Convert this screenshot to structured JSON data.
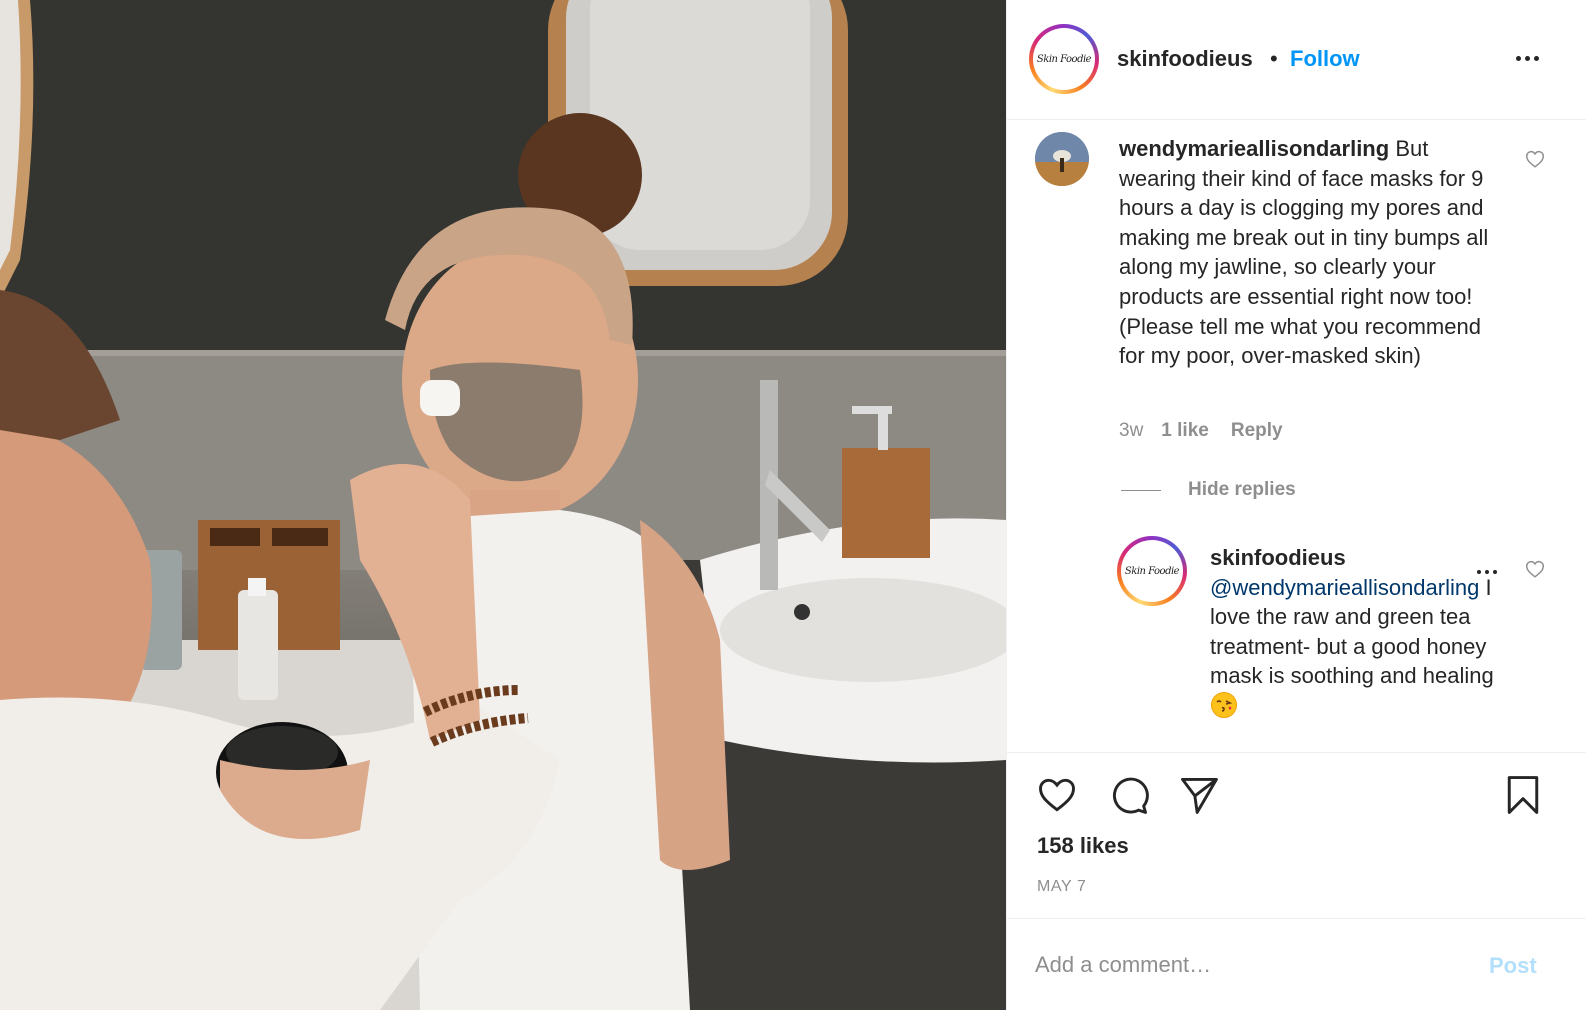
{
  "post": {
    "image_alt": "Woman applying clay face mask to smiling girl in a bathroom",
    "brand_logo_text": "Skin Foodie"
  },
  "header": {
    "username": "skinfoodieus",
    "separator": "•",
    "follow_label": "Follow",
    "more_icon": "more-horizontal-icon"
  },
  "comment": {
    "username": "wendymarieallisondarling",
    "text": "But wearing their kind of face masks for 9 hours a day is clogging my pores and making me break out in tiny bumps all along my jawline, so clearly your products are essential right now too! (Please tell me what you recommend for my poor, over-masked skin)",
    "time": "3w",
    "likes": "1 like",
    "reply_label": "Reply",
    "hide_replies_label": "Hide replies"
  },
  "reply": {
    "username": "skinfoodieus",
    "mention": "@wendymarieallisondarling",
    "text": " I love the raw and green tea treatment- but a good honey mask is soothing and healing",
    "emoji": "face-blowing-a-kiss-emoji"
  },
  "actions": {
    "like_icon": "heart-icon",
    "comment_icon": "comment-bubble-icon",
    "share_icon": "paper-plane-icon",
    "save_icon": "bookmark-icon",
    "likes_count": "158 likes",
    "date": "MAY 7"
  },
  "add_comment": {
    "placeholder": "Add a comment…",
    "post_label": "Post"
  },
  "colors": {
    "link_blue": "#0095f6",
    "mention_blue": "#00376b",
    "muted": "#8e8e8e",
    "post_disabled": "#b2dffc",
    "text": "#262626"
  }
}
